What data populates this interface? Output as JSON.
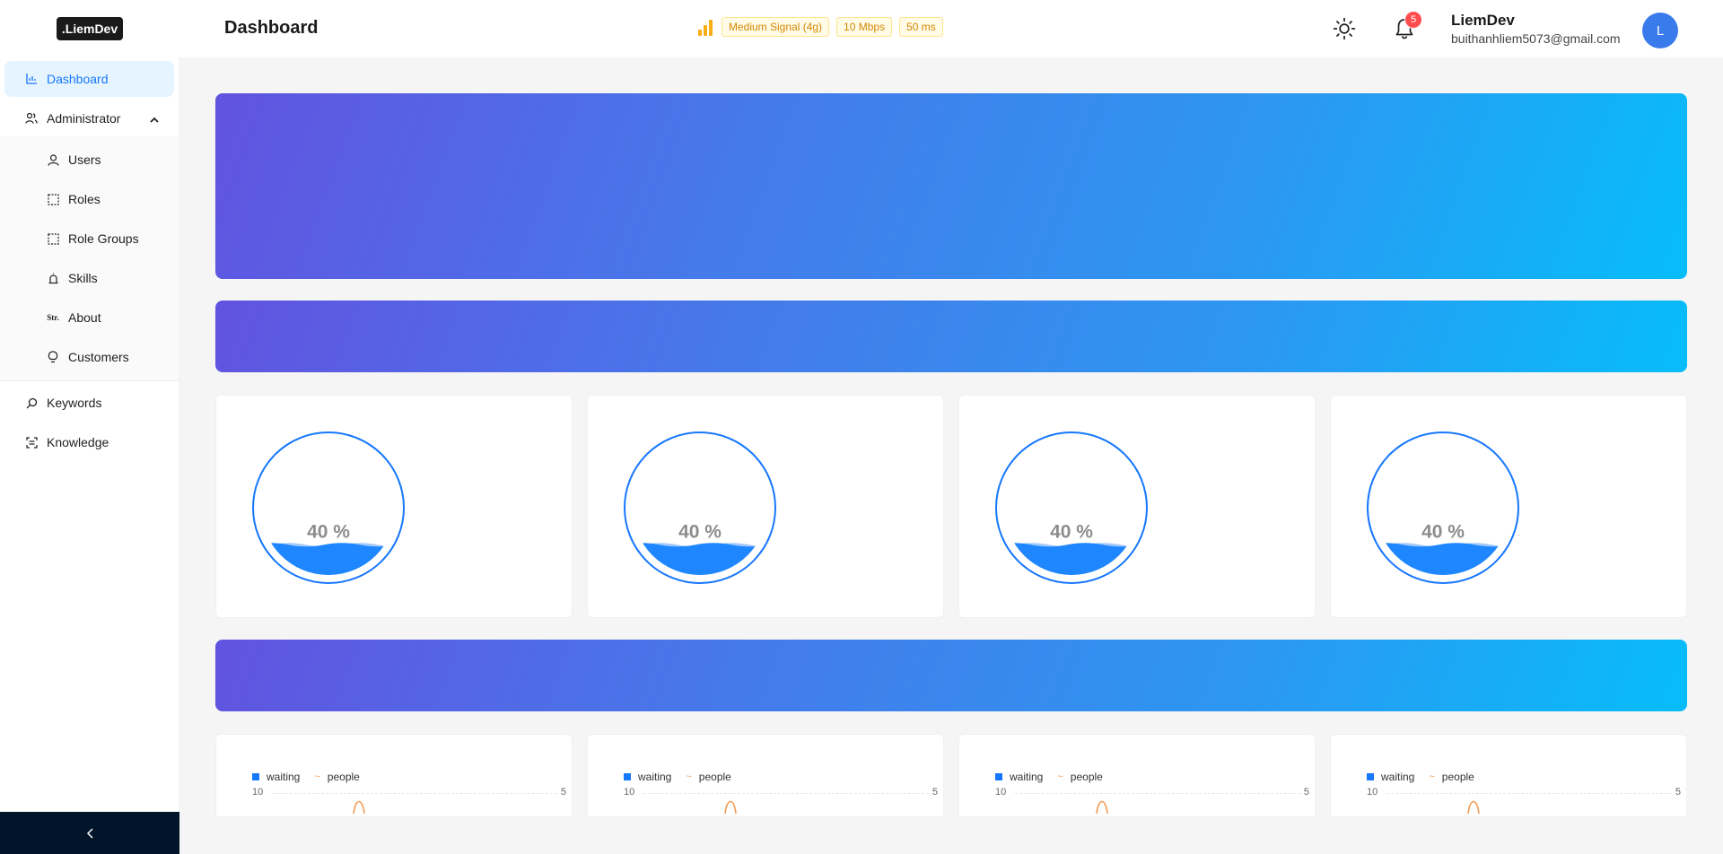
{
  "header": {
    "logo": ".LiemDev",
    "page_title": "Dashboard",
    "network": {
      "signal": "Medium Signal (4g)",
      "speed": "10 Mbps",
      "latency": "50 ms"
    },
    "notifications_count": "5",
    "user": {
      "name": "LiemDev",
      "email": "buithanhliem5073@gmail.com",
      "avatar_initial": "L"
    }
  },
  "sidebar": {
    "dashboard": "Dashboard",
    "administrator": "Administrator",
    "admin_items": [
      "Users",
      "Roles",
      "Role Groups",
      "Skills",
      "About",
      "Customers"
    ],
    "keywords": "Keywords",
    "knowledge": "Knowledge"
  },
  "gauges": [
    {
      "value": 0.4,
      "label": "40 %"
    },
    {
      "value": 0.4,
      "label": "40 %"
    },
    {
      "value": 0.4,
      "label": "40 %"
    },
    {
      "value": 0.4,
      "label": "40 %"
    }
  ],
  "mini_charts": [
    {
      "legend": [
        "waiting",
        "people"
      ],
      "left_tick": "10",
      "right_tick": "5"
    },
    {
      "legend": [
        "waiting",
        "people"
      ],
      "left_tick": "10",
      "right_tick": "5"
    },
    {
      "legend": [
        "waiting",
        "people"
      ],
      "left_tick": "10",
      "right_tick": "5"
    },
    {
      "legend": [
        "waiting",
        "people"
      ],
      "left_tick": "10",
      "right_tick": "5"
    }
  ],
  "colors": {
    "primary": "#1677ff",
    "gradient_start": "#6153e0",
    "gradient_end": "#07bdf9",
    "sidebar_footer": "#001529",
    "warning": "#faad14"
  }
}
